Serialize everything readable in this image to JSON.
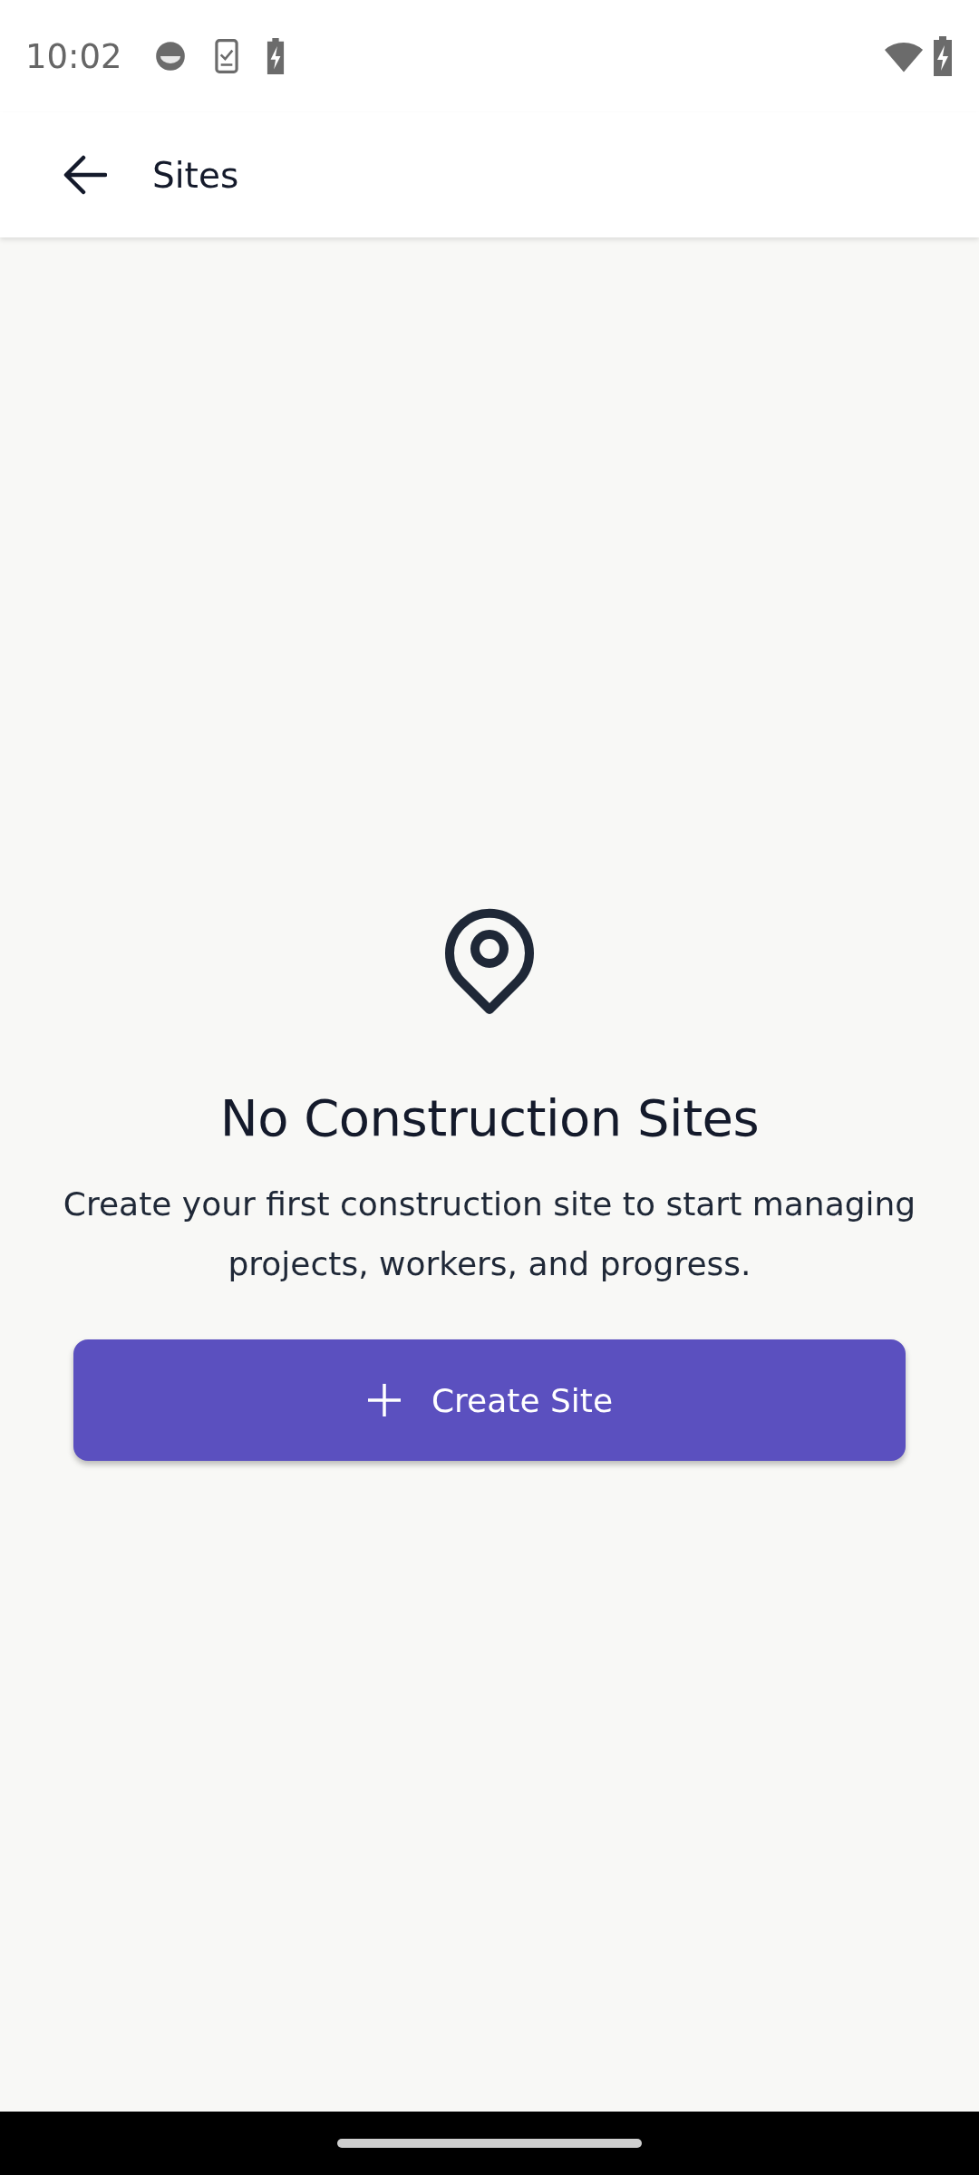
{
  "status_bar": {
    "time": "10:02"
  },
  "app_bar": {
    "title": "Sites"
  },
  "empty_state": {
    "title": "No Construction Sites",
    "message": "Create your first construction site to start managing projects, workers, and progress.",
    "button": "Create Site"
  }
}
